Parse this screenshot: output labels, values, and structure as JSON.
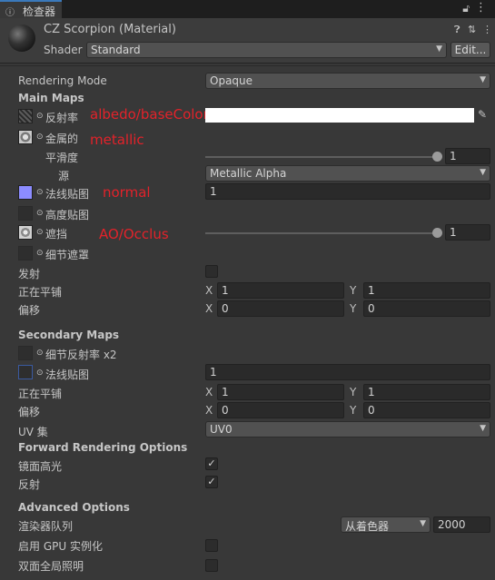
{
  "tab": {
    "label": "检查器",
    "icon": "inspector-icon"
  },
  "header": {
    "title": "CZ Scorpion (Material)",
    "shader_label": "Shader",
    "shader_value": "Standard",
    "edit_button": "Edit..."
  },
  "rendering_mode": {
    "label": "Rendering Mode",
    "value": "Opaque"
  },
  "main_maps": {
    "heading": "Main Maps",
    "albedo": {
      "label": "反射率",
      "annotation": "albedo/baseColor"
    },
    "metallic": {
      "label": "金属的",
      "annotation": "metallic"
    },
    "smoothness": {
      "label": "平滑度",
      "value": "1",
      "level": 1.0
    },
    "source": {
      "label": "源",
      "value": "Metallic Alpha"
    },
    "normal": {
      "label": "法线贴图",
      "annotation": "normal",
      "value": "1"
    },
    "height": {
      "label": "高度贴图"
    },
    "occlusion": {
      "label": "遮挡",
      "annotation": "AO/Occlus",
      "value": "1",
      "level": 1.0
    },
    "detail_mask": {
      "label": "细节遮罩"
    },
    "emission": {
      "label": "发射"
    },
    "tiling": {
      "label": "正在平铺",
      "x_label": "X",
      "x": "1",
      "y_label": "Y",
      "y": "1"
    },
    "offset": {
      "label": "偏移",
      "x_label": "X",
      "x": "0",
      "y_label": "Y",
      "y": "0"
    }
  },
  "secondary_maps": {
    "heading": "Secondary Maps",
    "detail_albedo": {
      "label": "细节反射率 x2"
    },
    "normal": {
      "label": "法线贴图",
      "value": "1"
    },
    "tiling": {
      "label": "正在平铺",
      "x_label": "X",
      "x": "1",
      "y_label": "Y",
      "y": "1"
    },
    "offset": {
      "label": "偏移",
      "x_label": "X",
      "x": "0",
      "y_label": "Y",
      "y": "0"
    },
    "uv_set": {
      "label": "UV 集",
      "value": "UV0"
    }
  },
  "forward_options": {
    "heading": "Forward Rendering Options",
    "specular": {
      "label": "镜面高光",
      "checked": true
    },
    "reflections": {
      "label": "反射",
      "checked": true
    }
  },
  "advanced_options": {
    "heading": "Advanced Options",
    "render_queue": {
      "label": "渲染器队列",
      "dropdown": "从着色器",
      "value": "2000"
    },
    "gpu_instancing": {
      "label": "启用 GPU 实例化",
      "checked": false
    },
    "double_sided_gi": {
      "label": "双面全局照明",
      "checked": false
    }
  },
  "check_mark": "✓",
  "colors": {
    "accent": "#3a79bb",
    "annotation": "#e3222a",
    "normal_swatch": "#8c8cff"
  }
}
